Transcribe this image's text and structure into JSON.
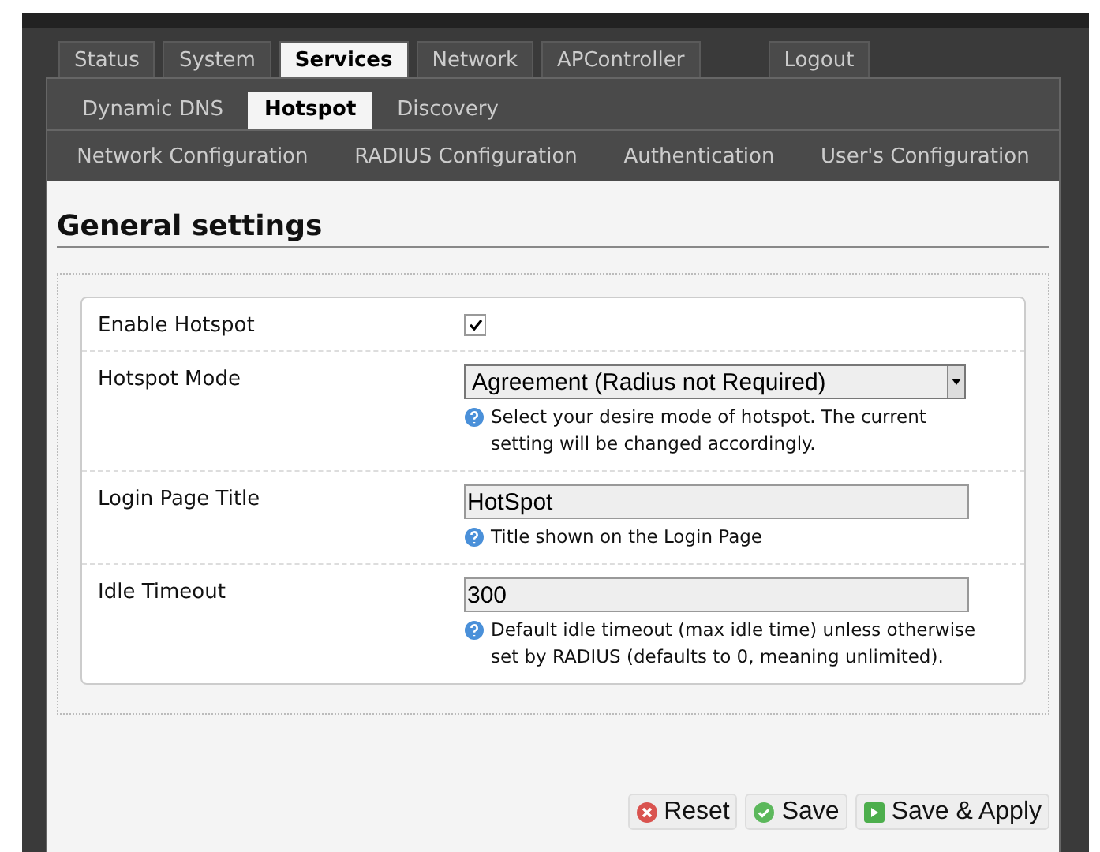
{
  "main_tabs": [
    {
      "label": "Status",
      "selected": false
    },
    {
      "label": "System",
      "selected": false
    },
    {
      "label": "Services",
      "selected": true
    },
    {
      "label": "Network",
      "selected": false
    },
    {
      "label": "APController",
      "selected": false
    },
    {
      "label": "Logout",
      "selected": false
    }
  ],
  "sub_tabs": [
    {
      "label": "Dynamic DNS",
      "selected": false
    },
    {
      "label": "Hotspot",
      "selected": true
    },
    {
      "label": "Discovery",
      "selected": false
    }
  ],
  "section_tabs": [
    {
      "label": "Network Configuration"
    },
    {
      "label": "RADIUS Configuration"
    },
    {
      "label": "Authentication"
    },
    {
      "label": "User's Configuration"
    }
  ],
  "heading": "General settings",
  "fields": [
    {
      "kind": "checkbox",
      "label": "Enable Hotspot",
      "checked": true
    },
    {
      "kind": "select",
      "label": "Hotspot Mode",
      "value": "Agreement (Radius not Required)",
      "help": "Select your desire mode of hotspot. The current setting will be changed accordingly."
    },
    {
      "kind": "text",
      "label": "Login Page Title",
      "value": "HotSpot",
      "help": "Title shown on the Login Page"
    },
    {
      "kind": "text",
      "label": "Idle Timeout",
      "value": "300",
      "help": "Default idle timeout (max idle time) unless otherwise set by RADIUS (defaults to 0, meaning unlimited)."
    }
  ],
  "buttons": [
    {
      "kind": "reset",
      "label": "Reset"
    },
    {
      "kind": "save",
      "label": "Save"
    },
    {
      "kind": "apply",
      "label": "Save & Apply"
    }
  ]
}
